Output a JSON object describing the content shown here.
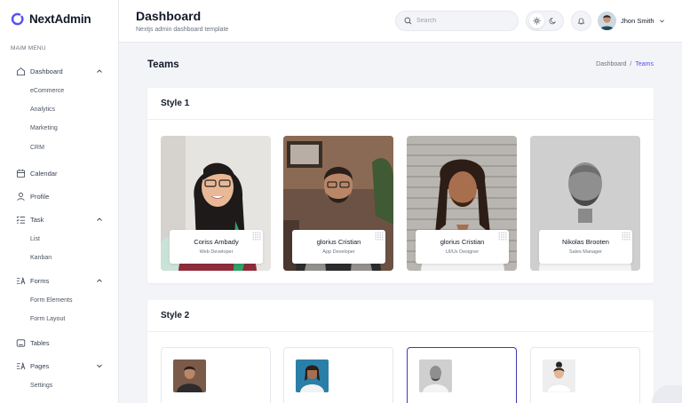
{
  "app": {
    "name": "NextAdmin"
  },
  "sidebar": {
    "menu_title": "MAIM MENU",
    "items": [
      {
        "label": "Dashboard",
        "icon": "home-icon",
        "expanded": true,
        "children": [
          "eCommerce",
          "Analytics",
          "Marketing",
          "CRM"
        ]
      },
      {
        "label": "Calendar",
        "icon": "calendar-icon"
      },
      {
        "label": "Profile",
        "icon": "user-icon"
      },
      {
        "label": "Task",
        "icon": "task-list-icon",
        "expanded": true,
        "children": [
          "List",
          "Kanban"
        ]
      },
      {
        "label": "Forms",
        "icon": "forms-icon",
        "expanded": true,
        "children": [
          "Form Elements",
          "Form Layout"
        ]
      },
      {
        "label": "Tables",
        "icon": "table-icon"
      },
      {
        "label": "Pages",
        "icon": "pages-icon",
        "expanded": false,
        "children": [
          "Settings"
        ]
      }
    ]
  },
  "header": {
    "title": "Dashboard",
    "subtitle": "Nextjs admin dashboard template",
    "search_placeholder": "Search",
    "user_name": "Jhon Smith",
    "theme_active": "light"
  },
  "page": {
    "title": "Teams",
    "breadcrumb": [
      "Dashboard",
      "Teams"
    ],
    "style1": {
      "title": "Style 1",
      "members": [
        {
          "name": "Coriss Ambady",
          "role": "Web Developer"
        },
        {
          "name": "glorius Cristian",
          "role": "App Developer"
        },
        {
          "name": "glorius Cristian",
          "role": "UI/Ux Designer"
        },
        {
          "name": "Nikolas Brooten",
          "role": "Sales Manager"
        }
      ]
    },
    "style2": {
      "title": "Style 2",
      "selected_index": 2
    }
  },
  "colors": {
    "accent": "#5750f1",
    "selected_border": "#3e3ab3",
    "sidebar_bg": "#ffffff",
    "page_bg": "#f3f4f7"
  }
}
